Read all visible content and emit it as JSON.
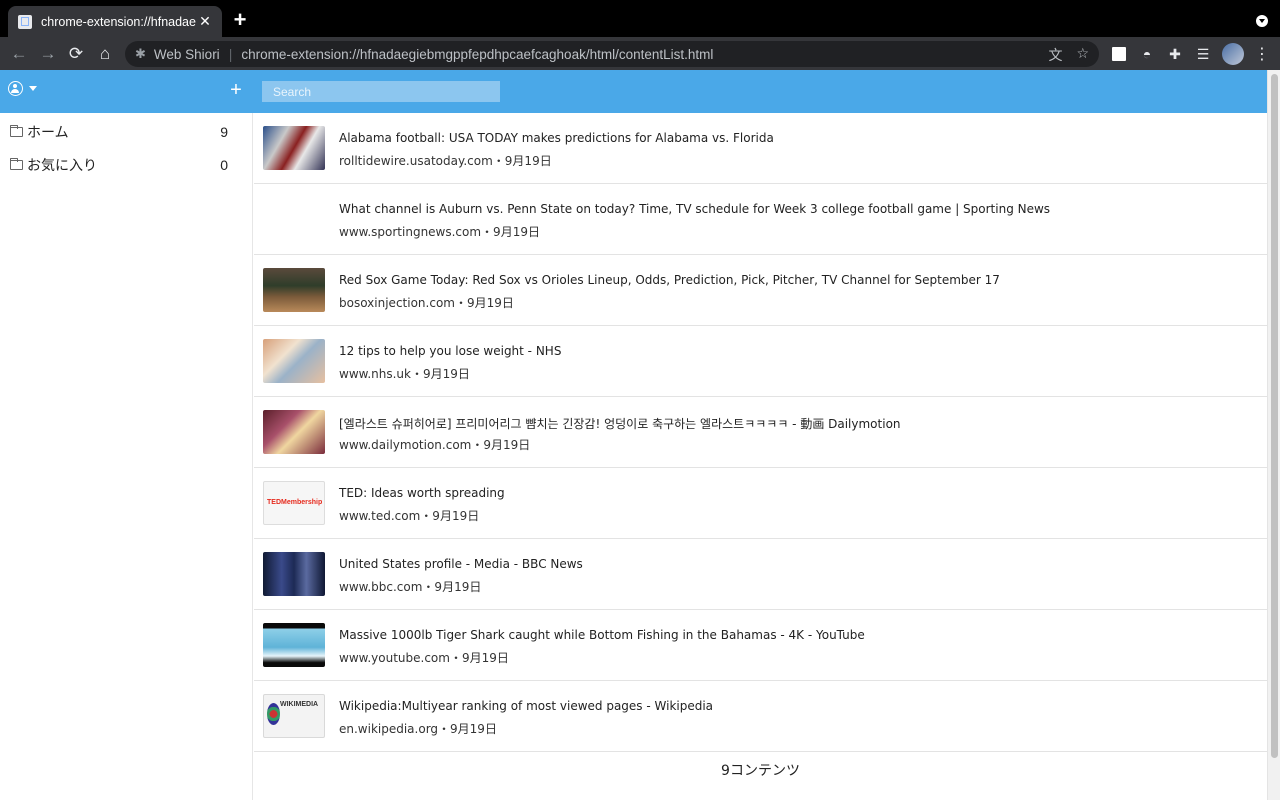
{
  "browser": {
    "tab_title": "chrome-extension://hfnadaegiebmgppfepdhpcaefcaghoak/html/contentList.html",
    "tab_close": "✕",
    "new_tab": "+",
    "nav": {
      "back": "←",
      "forward": "→",
      "reload": "⟳",
      "home": "⌂"
    },
    "omnibox": {
      "ext_icon": "✱",
      "site_name": "Web Shiori",
      "separator": "|",
      "url": "chrome-extension://hfnadaegiebmgppfepdhpcaefcaghoak/html/contentList.html",
      "translate_icon": "文",
      "star_icon": "☆"
    },
    "toolbar_icons": [
      "extension-square-icon",
      "glasses-icon",
      "puzzle-icon",
      "reading-list-icon",
      "profile-avatar-icon",
      "menu-dots-icon"
    ]
  },
  "header": {
    "add_label": "+",
    "search_placeholder": "Search"
  },
  "sidebar": {
    "folders": [
      {
        "name": "ホーム",
        "count": "9"
      },
      {
        "name": "お気に入り",
        "count": "0"
      }
    ]
  },
  "content": {
    "items": [
      {
        "title": "Alabama football: USA TODAY makes predictions for Alabama vs. Florida",
        "meta": "rolltidewire.usatoday.com・9月19日",
        "thumb": "football-photo"
      },
      {
        "title": "What channel is Auburn vs. Penn State on today? Time, TV schedule for Week 3 college football game | Sporting News",
        "meta": "www.sportingnews.com・9月19日",
        "thumb": ""
      },
      {
        "title": "Red Sox Game Today: Red Sox vs Orioles Lineup, Odds, Prediction, Pick, Pitcher, TV Channel for September 17",
        "meta": "bosoxinjection.com・9月19日",
        "thumb": "baseball-photo"
      },
      {
        "title": "12 tips to help you lose weight - NHS",
        "meta": "www.nhs.uk・9月19日",
        "thumb": "food-photo"
      },
      {
        "title": "[엘라스트 슈퍼히어로] 프리미어리그 뺨치는 긴장감! 엉덩이로 축구하는 엘라스트ㅋㅋㅋㅋ - 動画 Dailymotion",
        "meta": "www.dailymotion.com・9月19日",
        "thumb": "video-photo"
      },
      {
        "title": "TED: Ideas worth spreading",
        "meta": "www.ted.com・9月19日",
        "thumb": "ted-logo"
      },
      {
        "title": "United States profile - Media - BBC News",
        "meta": "www.bbc.com・9月19日",
        "thumb": "news-photo"
      },
      {
        "title": "Massive 1000lb Tiger Shark caught while Bottom Fishing in the Bahamas - 4K - YouTube",
        "meta": "www.youtube.com・9月19日",
        "thumb": "shark-photo"
      },
      {
        "title": "Wikipedia:Multiyear ranking of most viewed pages - Wikipedia",
        "meta": "en.wikipedia.org・9月19日",
        "thumb": "wikimedia-logo"
      }
    ],
    "footer": "9コンテンツ"
  },
  "thumb_text": {
    "ted": "TEDMembership",
    "wikimedia": "WIKIMEDIA"
  },
  "colors": {
    "header": "#4aa8e8",
    "search_bg": "#8cc6ef",
    "chrome_dark": "#35363a"
  }
}
